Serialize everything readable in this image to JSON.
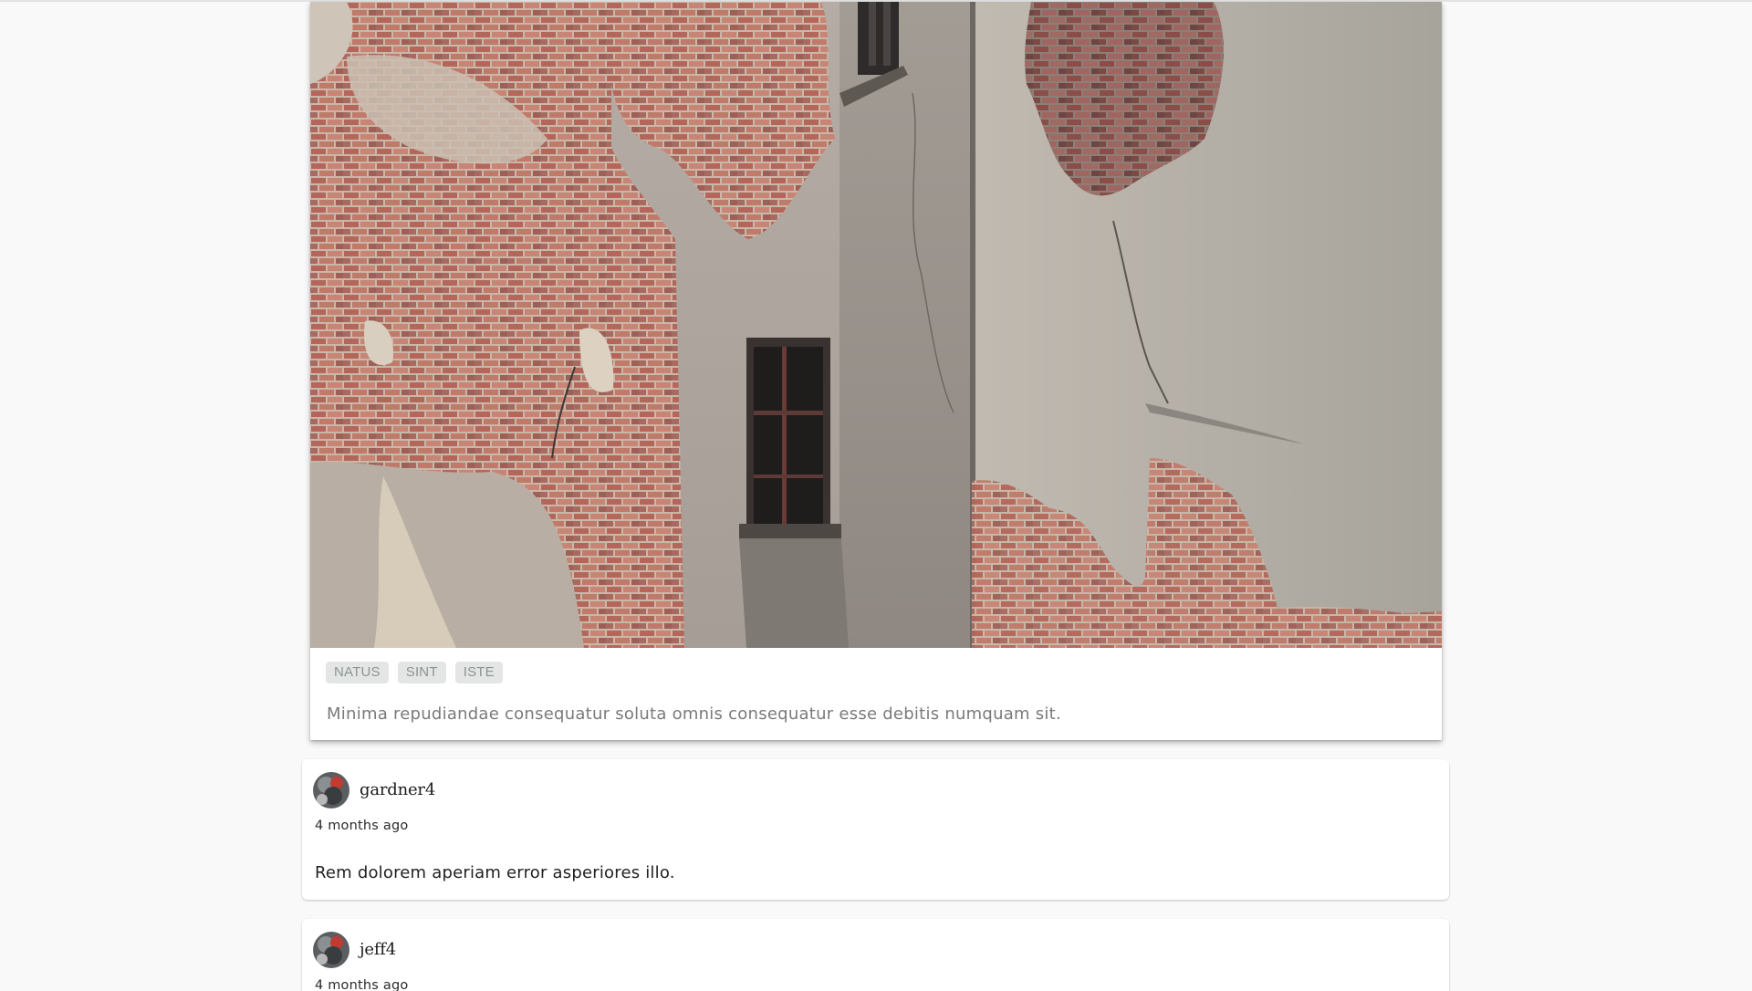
{
  "post": {
    "image_icon": "crumbling-brick-building-photo",
    "tags": [
      "NATUS",
      "SINT",
      "ISTE"
    ],
    "description": "Minima repudiandae consequatur soluta omnis consequatur esse debitis numquam sit."
  },
  "comments": [
    {
      "avatar_icon": "user-avatar-photo",
      "username": "gardner4",
      "time": "4 months ago",
      "body": "Rem dolorem aperiam error asperiores illo."
    },
    {
      "avatar_icon": "user-avatar-photo",
      "username": "jeff4",
      "time": "4 months ago",
      "body": ""
    }
  ],
  "colors": {
    "page_background": "#f9f9f9",
    "card_background": "#ffffff",
    "tag_background": "#e4e6e6",
    "tag_text": "#8b9393",
    "description_text": "#7a7a7a"
  }
}
